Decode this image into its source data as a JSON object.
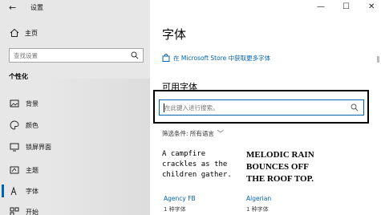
{
  "window": {
    "title": "设置",
    "minimize": "—",
    "maximize": "☐",
    "close": "✕"
  },
  "sidebar": {
    "home_label": "主页",
    "search_placeholder": "查找设置",
    "section_title": "个性化",
    "items": [
      {
        "label": "背景",
        "icon": "image-icon"
      },
      {
        "label": "颜色",
        "icon": "palette-icon"
      },
      {
        "label": "锁屏界面",
        "icon": "lock-screen-icon"
      },
      {
        "label": "主题",
        "icon": "theme-icon"
      },
      {
        "label": "字体",
        "icon": "font-icon",
        "selected": true
      },
      {
        "label": "开始",
        "icon": "start-icon"
      }
    ]
  },
  "main": {
    "title": "字体",
    "store_link": "在 Microsoft Store 中获取更多字体",
    "available_heading": "可用字体",
    "font_search_placeholder": "在此键入进行搜索。",
    "filter_label": "筛选条件: 所有语言",
    "fonts": [
      {
        "sample": "A campfire crackles as the children gather.",
        "name": "Agency FB",
        "count": "1 种字体"
      },
      {
        "sample": "MELODIC RAIN BOUNCES OFF THE ROOF TOP.",
        "name": "Algerian",
        "count": "1 种字体"
      }
    ]
  },
  "colors": {
    "accent": "#0063b1",
    "sidebar_bg": "#e7e7e7"
  }
}
